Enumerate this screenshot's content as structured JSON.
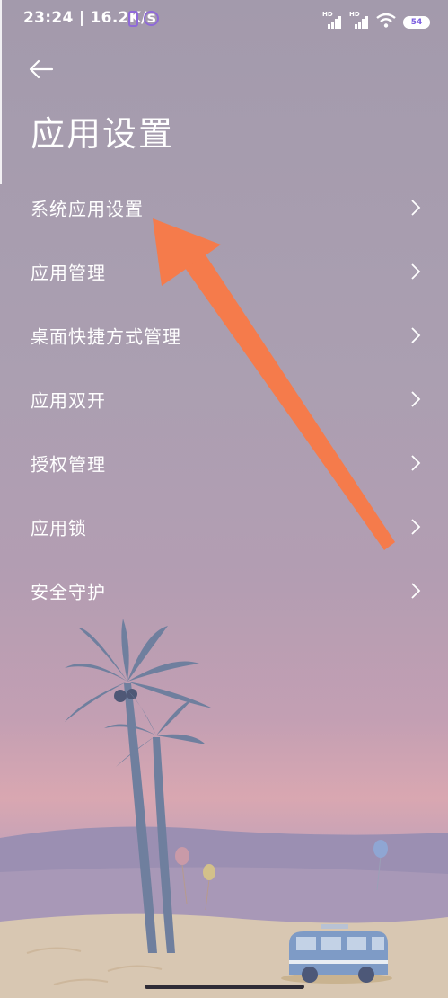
{
  "status_bar": {
    "time_speed": "23:24 | 16.2K/s",
    "battery": "54",
    "hd_label": "HD"
  },
  "header": {
    "back_icon": "back-arrow-icon",
    "title": "应用设置"
  },
  "menu": {
    "items": [
      {
        "label": "系统应用设置"
      },
      {
        "label": "应用管理"
      },
      {
        "label": "桌面快捷方式管理"
      },
      {
        "label": "应用双开"
      },
      {
        "label": "授权管理"
      },
      {
        "label": "应用锁"
      },
      {
        "label": "安全守护"
      }
    ]
  },
  "colors": {
    "accent_arrow": "#f57b4b",
    "status_icon": "#8f6ad8"
  }
}
